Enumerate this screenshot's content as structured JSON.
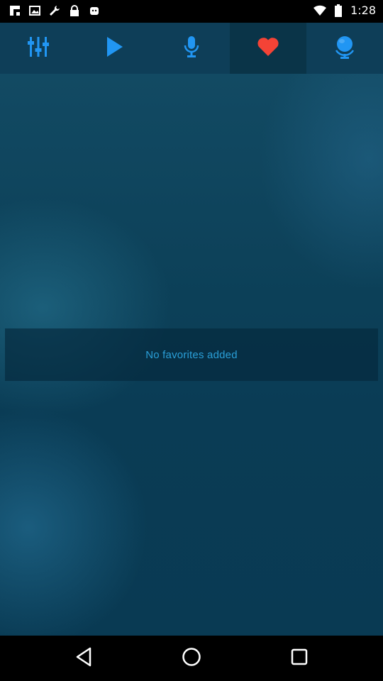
{
  "status_bar": {
    "time": "1:28",
    "left_icons": [
      "flipboard-icon",
      "image-icon",
      "wrench-icon",
      "lock-icon",
      "android-icon"
    ],
    "right_icons": [
      "wifi-icon",
      "battery-icon"
    ]
  },
  "toolbar": {
    "buttons": [
      {
        "name": "equalizer-icon",
        "active": false
      },
      {
        "name": "play-icon",
        "active": false
      },
      {
        "name": "microphone-icon",
        "active": false
      },
      {
        "name": "heart-icon",
        "active": true
      },
      {
        "name": "globe-mic-icon",
        "active": false
      }
    ],
    "accent": "#2196f3",
    "heart_color": "#f44336"
  },
  "favorites": {
    "empty_message": "No favorites added"
  },
  "nav_bar": {
    "buttons": [
      "back-icon",
      "home-icon",
      "recents-icon"
    ]
  }
}
